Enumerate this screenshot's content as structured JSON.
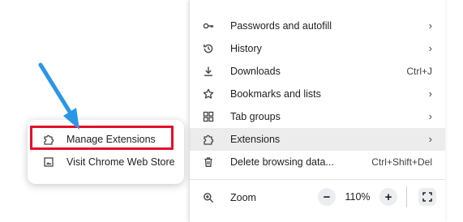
{
  "main_menu": {
    "items": [
      {
        "label": "Passwords and autofill",
        "icon": "key-icon",
        "has_submenu": true
      },
      {
        "label": "History",
        "icon": "history-icon",
        "has_submenu": true
      },
      {
        "label": "Downloads",
        "icon": "download-icon",
        "shortcut": "Ctrl+J"
      },
      {
        "label": "Bookmarks and lists",
        "icon": "star-icon",
        "has_submenu": true
      },
      {
        "label": "Tab groups",
        "icon": "tab-groups-icon",
        "has_submenu": true
      },
      {
        "label": "Extensions",
        "icon": "puzzle-icon",
        "has_submenu": true,
        "highlighted": true
      },
      {
        "label": "Delete browsing data...",
        "icon": "trash-icon",
        "shortcut": "Ctrl+Shift+Del"
      }
    ],
    "chevron": "›",
    "zoom": {
      "label": "Zoom",
      "icon": "zoom-icon",
      "minus": "−",
      "value": "110%",
      "plus": "+",
      "fullscreen_icon": "fullscreen-icon"
    }
  },
  "submenu": {
    "items": [
      {
        "label": "Manage Extensions",
        "icon": "puzzle-icon"
      },
      {
        "label": "Visit Chrome Web Store",
        "icon": "web-store-icon"
      }
    ]
  },
  "annotation": {
    "highlight_color": "#e3102a",
    "arrow_color": "#2a96e8"
  }
}
